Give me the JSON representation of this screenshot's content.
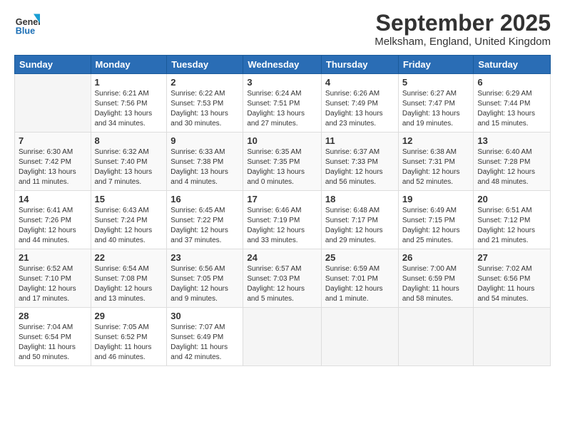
{
  "logo": {
    "general": "General",
    "blue": "Blue"
  },
  "title": "September 2025",
  "location": "Melksham, England, United Kingdom",
  "weekdays": [
    "Sunday",
    "Monday",
    "Tuesday",
    "Wednesday",
    "Thursday",
    "Friday",
    "Saturday"
  ],
  "weeks": [
    [
      {
        "day": "",
        "info": ""
      },
      {
        "day": "1",
        "info": "Sunrise: 6:21 AM\nSunset: 7:56 PM\nDaylight: 13 hours\nand 34 minutes."
      },
      {
        "day": "2",
        "info": "Sunrise: 6:22 AM\nSunset: 7:53 PM\nDaylight: 13 hours\nand 30 minutes."
      },
      {
        "day": "3",
        "info": "Sunrise: 6:24 AM\nSunset: 7:51 PM\nDaylight: 13 hours\nand 27 minutes."
      },
      {
        "day": "4",
        "info": "Sunrise: 6:26 AM\nSunset: 7:49 PM\nDaylight: 13 hours\nand 23 minutes."
      },
      {
        "day": "5",
        "info": "Sunrise: 6:27 AM\nSunset: 7:47 PM\nDaylight: 13 hours\nand 19 minutes."
      },
      {
        "day": "6",
        "info": "Sunrise: 6:29 AM\nSunset: 7:44 PM\nDaylight: 13 hours\nand 15 minutes."
      }
    ],
    [
      {
        "day": "7",
        "info": "Sunrise: 6:30 AM\nSunset: 7:42 PM\nDaylight: 13 hours\nand 11 minutes."
      },
      {
        "day": "8",
        "info": "Sunrise: 6:32 AM\nSunset: 7:40 PM\nDaylight: 13 hours\nand 7 minutes."
      },
      {
        "day": "9",
        "info": "Sunrise: 6:33 AM\nSunset: 7:38 PM\nDaylight: 13 hours\nand 4 minutes."
      },
      {
        "day": "10",
        "info": "Sunrise: 6:35 AM\nSunset: 7:35 PM\nDaylight: 13 hours\nand 0 minutes."
      },
      {
        "day": "11",
        "info": "Sunrise: 6:37 AM\nSunset: 7:33 PM\nDaylight: 12 hours\nand 56 minutes."
      },
      {
        "day": "12",
        "info": "Sunrise: 6:38 AM\nSunset: 7:31 PM\nDaylight: 12 hours\nand 52 minutes."
      },
      {
        "day": "13",
        "info": "Sunrise: 6:40 AM\nSunset: 7:28 PM\nDaylight: 12 hours\nand 48 minutes."
      }
    ],
    [
      {
        "day": "14",
        "info": "Sunrise: 6:41 AM\nSunset: 7:26 PM\nDaylight: 12 hours\nand 44 minutes."
      },
      {
        "day": "15",
        "info": "Sunrise: 6:43 AM\nSunset: 7:24 PM\nDaylight: 12 hours\nand 40 minutes."
      },
      {
        "day": "16",
        "info": "Sunrise: 6:45 AM\nSunset: 7:22 PM\nDaylight: 12 hours\nand 37 minutes."
      },
      {
        "day": "17",
        "info": "Sunrise: 6:46 AM\nSunset: 7:19 PM\nDaylight: 12 hours\nand 33 minutes."
      },
      {
        "day": "18",
        "info": "Sunrise: 6:48 AM\nSunset: 7:17 PM\nDaylight: 12 hours\nand 29 minutes."
      },
      {
        "day": "19",
        "info": "Sunrise: 6:49 AM\nSunset: 7:15 PM\nDaylight: 12 hours\nand 25 minutes."
      },
      {
        "day": "20",
        "info": "Sunrise: 6:51 AM\nSunset: 7:12 PM\nDaylight: 12 hours\nand 21 minutes."
      }
    ],
    [
      {
        "day": "21",
        "info": "Sunrise: 6:52 AM\nSunset: 7:10 PM\nDaylight: 12 hours\nand 17 minutes."
      },
      {
        "day": "22",
        "info": "Sunrise: 6:54 AM\nSunset: 7:08 PM\nDaylight: 12 hours\nand 13 minutes."
      },
      {
        "day": "23",
        "info": "Sunrise: 6:56 AM\nSunset: 7:05 PM\nDaylight: 12 hours\nand 9 minutes."
      },
      {
        "day": "24",
        "info": "Sunrise: 6:57 AM\nSunset: 7:03 PM\nDaylight: 12 hours\nand 5 minutes."
      },
      {
        "day": "25",
        "info": "Sunrise: 6:59 AM\nSunset: 7:01 PM\nDaylight: 12 hours\nand 1 minute."
      },
      {
        "day": "26",
        "info": "Sunrise: 7:00 AM\nSunset: 6:59 PM\nDaylight: 11 hours\nand 58 minutes."
      },
      {
        "day": "27",
        "info": "Sunrise: 7:02 AM\nSunset: 6:56 PM\nDaylight: 11 hours\nand 54 minutes."
      }
    ],
    [
      {
        "day": "28",
        "info": "Sunrise: 7:04 AM\nSunset: 6:54 PM\nDaylight: 11 hours\nand 50 minutes."
      },
      {
        "day": "29",
        "info": "Sunrise: 7:05 AM\nSunset: 6:52 PM\nDaylight: 11 hours\nand 46 minutes."
      },
      {
        "day": "30",
        "info": "Sunrise: 7:07 AM\nSunset: 6:49 PM\nDaylight: 11 hours\nand 42 minutes."
      },
      {
        "day": "",
        "info": ""
      },
      {
        "day": "",
        "info": ""
      },
      {
        "day": "",
        "info": ""
      },
      {
        "day": "",
        "info": ""
      }
    ]
  ]
}
